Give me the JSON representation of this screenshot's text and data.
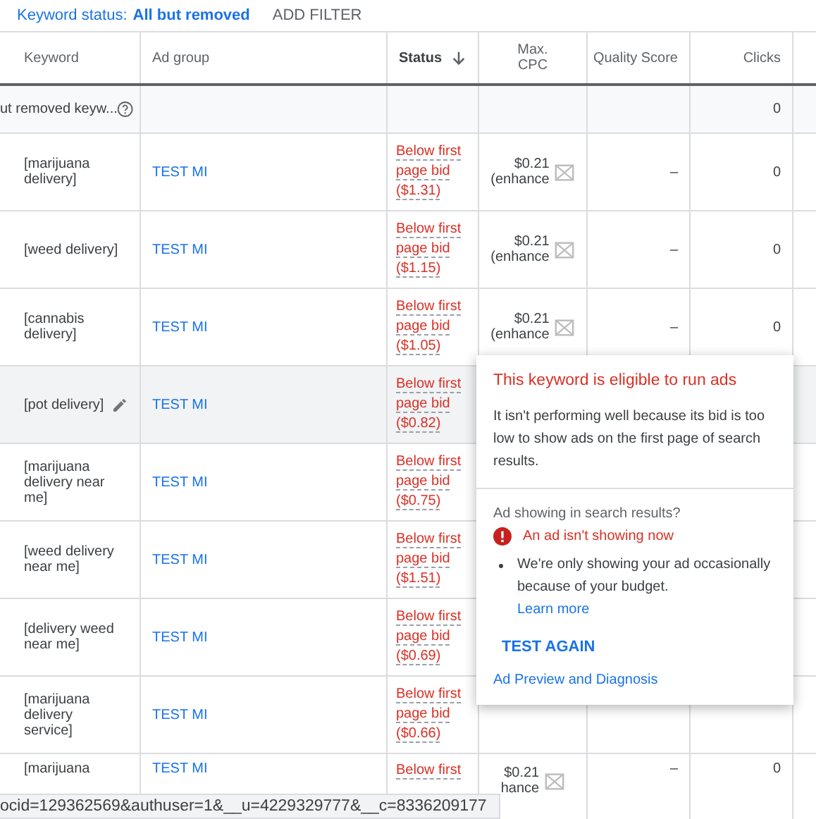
{
  "filter_bar": {
    "label": "Keyword status:",
    "value": "All but removed",
    "action": "ADD FILTER"
  },
  "table": {
    "columns": [
      {
        "label": "Keyword",
        "sorted": false
      },
      {
        "label": "Ad group",
        "sorted": false
      },
      {
        "label": "Status",
        "sorted": true
      },
      {
        "label": "Max. CPC",
        "sorted": false
      },
      {
        "label": "Quality Score",
        "sorted": false
      },
      {
        "label": "Clicks",
        "sorted": false
      }
    ],
    "summary_row": {
      "keyword": "ut removed keyw...",
      "clicks": "0"
    },
    "rows": [
      {
        "keyword": "[marijuana delivery]",
        "ad_group": "TEST MI",
        "status": "Below first page bid ($1.31)",
        "max_cpc": "$0.21",
        "cpc_note": "(enhance",
        "quality_score": "–",
        "clicks": "0",
        "hovered": false
      },
      {
        "keyword": "[weed delivery]",
        "ad_group": "TEST MI",
        "status": "Below first page bid ($1.15)",
        "max_cpc": "$0.21",
        "cpc_note": "(enhance",
        "quality_score": "–",
        "clicks": "0",
        "hovered": false
      },
      {
        "keyword": "[cannabis delivery]",
        "ad_group": "TEST MI",
        "status": "Below first page bid ($1.05)",
        "max_cpc": "$0.21",
        "cpc_note": "(enhance",
        "quality_score": "–",
        "clicks": "0",
        "hovered": false
      },
      {
        "keyword": "[pot delivery]",
        "ad_group": "TEST MI",
        "status": "Below first page bid ($0.82)",
        "hovered": true
      },
      {
        "keyword": "[marijuana delivery near me]",
        "ad_group": "TEST MI",
        "status": "Below first page bid ($0.75)",
        "hovered": false
      },
      {
        "keyword": "[weed delivery near me]",
        "ad_group": "TEST MI",
        "status": "Below first page bid ($1.51)",
        "hovered": false
      },
      {
        "keyword": "[delivery weed near me]",
        "ad_group": "TEST MI",
        "status": "Below first page bid ($0.69)",
        "hovered": false
      },
      {
        "keyword": "[marijuana delivery service]",
        "ad_group": "TEST MI",
        "status": "Below first page bid ($0.66)",
        "hovered": false
      },
      {
        "keyword": "[marijuana",
        "ad_group": "TEST MI",
        "status": "Below first",
        "max_cpc": "$0.21",
        "cpc_note": "hance",
        "quality_score": "–",
        "clicks": "0",
        "hovered": false
      }
    ]
  },
  "popup": {
    "title": "This keyword is eligible to run ads",
    "body": "It isn't performing well because its bid is too low to show ads on the first page of search results.",
    "section_label": "Ad showing in search results?",
    "alert": "An ad isn't showing now",
    "bullet": "We're only showing your ad occasionally because of your budget.",
    "link": "Learn more",
    "button": "TEST AGAIN",
    "footer_link": "Ad Preview and Diagnosis"
  },
  "status_url": "ocid=129362569&authuser=1&__u=4229329777&__c=8336209177"
}
